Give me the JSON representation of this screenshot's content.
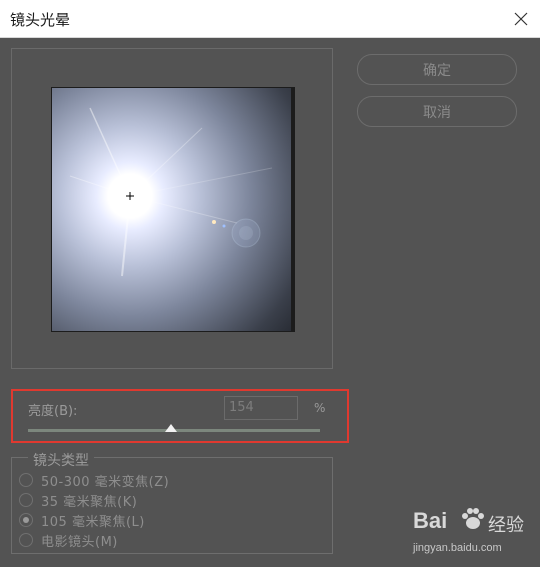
{
  "window": {
    "title": "镜头光晕",
    "close_icon": "close-icon"
  },
  "buttons": {
    "ok_label": "确定",
    "cancel_label": "取消"
  },
  "brightness": {
    "label": "亮度(B):",
    "value": "154",
    "unit": "%",
    "slider_fraction": 0.49
  },
  "lens_type": {
    "legend": "镜头类型",
    "options": [
      {
        "label": "50-300 毫米变焦(Z)",
        "selected": false
      },
      {
        "label": "35 毫米聚焦(K)",
        "selected": false
      },
      {
        "label": "105 毫米聚焦(L)",
        "selected": true
      },
      {
        "label": "电影镜头(M)",
        "selected": false
      }
    ]
  },
  "watermark": {
    "logo_text": "Bai",
    "brand_cn": "经验",
    "url": "jingyan.baidu.com"
  },
  "colors": {
    "highlight_border": "#e0392f",
    "dialog_bg": "#535353"
  }
}
